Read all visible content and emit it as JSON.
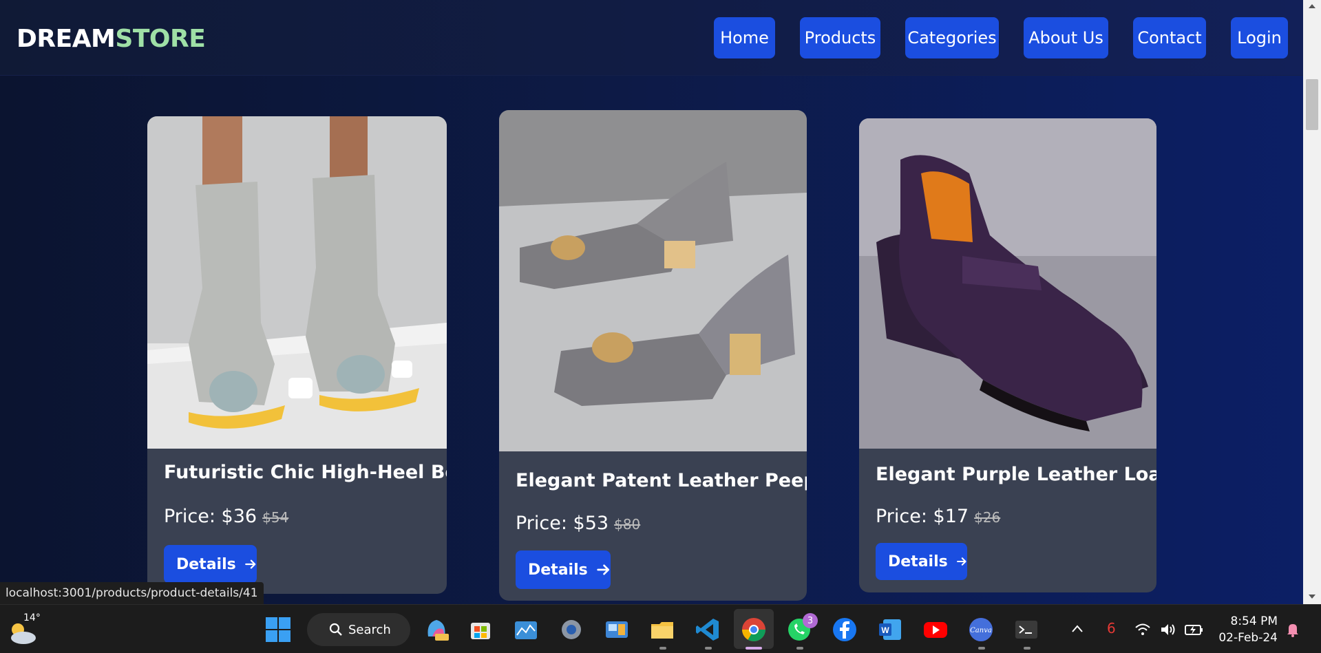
{
  "brand": {
    "part1": "DREAM",
    "part2": "STORE"
  },
  "nav": {
    "home": "Home",
    "products": "Products",
    "categories": "Categories",
    "about": "About Us",
    "contact": "Contact",
    "login": "Login"
  },
  "products": [
    {
      "title": "Futuristic Chic High-Heel Bo...",
      "price": "Price: $36",
      "old_price": "$54",
      "button": "Details"
    },
    {
      "title": "Elegant Patent Leather Peep...",
      "price": "Price: $53",
      "old_price": "$80",
      "button": "Details"
    },
    {
      "title": "Elegant Purple Leather Loaf...",
      "price": "Price: $17",
      "old_price": "$26",
      "button": "Details"
    }
  ],
  "status_url": "localhost:3001/products/product-details/41",
  "taskbar": {
    "weather_temp": "14°",
    "search_label": "Search",
    "whatsapp_badge": "3",
    "tray_count": "6",
    "time": "8:54 PM",
    "date": "02-Feb-24"
  },
  "colors": {
    "accent": "#1b4ee0",
    "brand_green": "#9fe0a6",
    "card_bg": "#3a4152"
  }
}
